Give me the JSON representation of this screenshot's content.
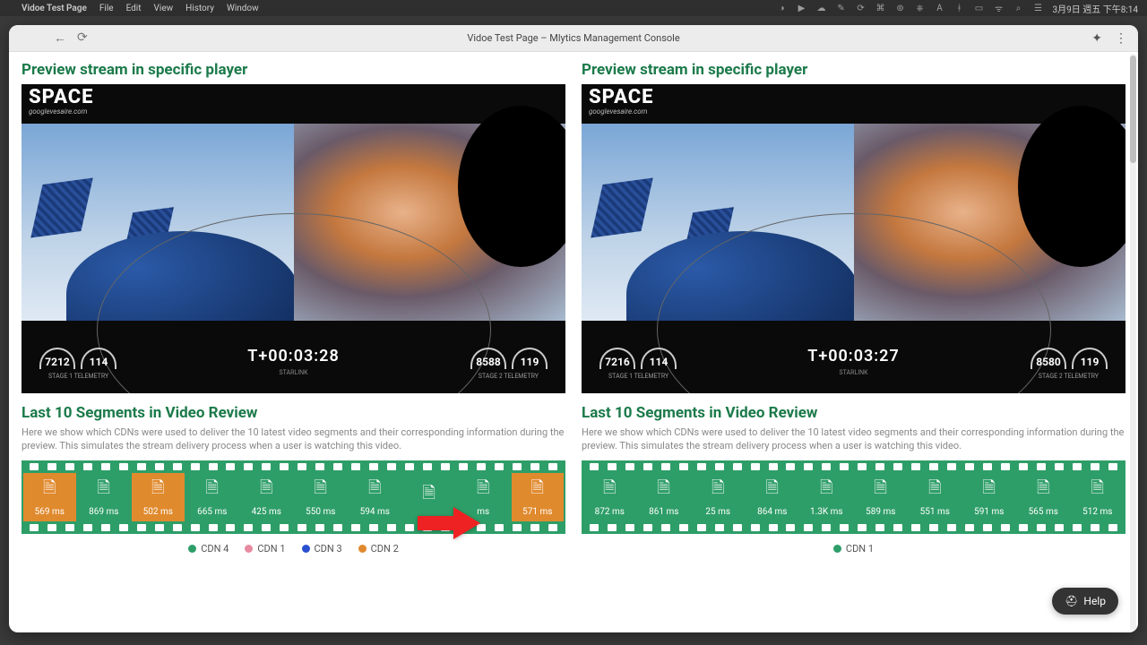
{
  "menubar": {
    "app": "Vidoe Test Page",
    "items": [
      "File",
      "Edit",
      "View",
      "History",
      "Window"
    ],
    "clock": "3月9日 週五 下午8:14"
  },
  "window": {
    "title": "Vidoe Test Page – Mlytics Management Console"
  },
  "sections": {
    "preview_title": "Preview stream in specific player",
    "segments_title": "Last 10 Segments in Video Review",
    "segments_desc": "Here we show which CDNs were used to deliver the 10 latest video segments and their corresponding information during the preview. This simulates the stream delivery process when a user is watching this video."
  },
  "player": {
    "brand": "SPACE",
    "brand_sub": "googlevesaire.com",
    "stage1_label": "STAGE 1 TELEMETRY",
    "stage2_label": "STAGE 2 TELEMETRY",
    "starlink_label": "STARLINK"
  },
  "left": {
    "telemetry": {
      "v1": "7212",
      "v2": "114",
      "v3": "8588",
      "v4": "119",
      "time": "T+00:03:28"
    },
    "segments": [
      {
        "label": "569 ms",
        "color": "orange"
      },
      {
        "label": "869 ms",
        "color": "green"
      },
      {
        "label": "502 ms",
        "color": "orange"
      },
      {
        "label": "665 ms",
        "color": "green"
      },
      {
        "label": "425 ms",
        "color": "green"
      },
      {
        "label": "550 ms",
        "color": "green"
      },
      {
        "label": "594 ms",
        "color": "green"
      },
      {
        "label": "",
        "color": "green"
      },
      {
        "label": "ms",
        "color": "green"
      },
      {
        "label": "571 ms",
        "color": "orange"
      }
    ],
    "legend": [
      {
        "name": "CDN 4",
        "color": "#2e9e68"
      },
      {
        "name": "CDN 1",
        "color": "#e88aa0"
      },
      {
        "name": "CDN 3",
        "color": "#2a4fcf"
      },
      {
        "name": "CDN 2",
        "color": "#e08a2e"
      }
    ]
  },
  "right": {
    "telemetry": {
      "v1": "7216",
      "v2": "114",
      "v3": "8580",
      "v4": "119",
      "time": "T+00:03:27"
    },
    "segments": [
      {
        "label": "872 ms",
        "color": "green"
      },
      {
        "label": "861 ms",
        "color": "green"
      },
      {
        "label": "25 ms",
        "color": "green"
      },
      {
        "label": "864 ms",
        "color": "green"
      },
      {
        "label": "1.3K ms",
        "color": "green"
      },
      {
        "label": "589 ms",
        "color": "green"
      },
      {
        "label": "551 ms",
        "color": "green"
      },
      {
        "label": "591 ms",
        "color": "green"
      },
      {
        "label": "565 ms",
        "color": "green"
      },
      {
        "label": "512 ms",
        "color": "green"
      }
    ],
    "legend": [
      {
        "name": "CDN 1",
        "color": "#2e9e68"
      }
    ]
  },
  "help": {
    "label": "Help"
  }
}
